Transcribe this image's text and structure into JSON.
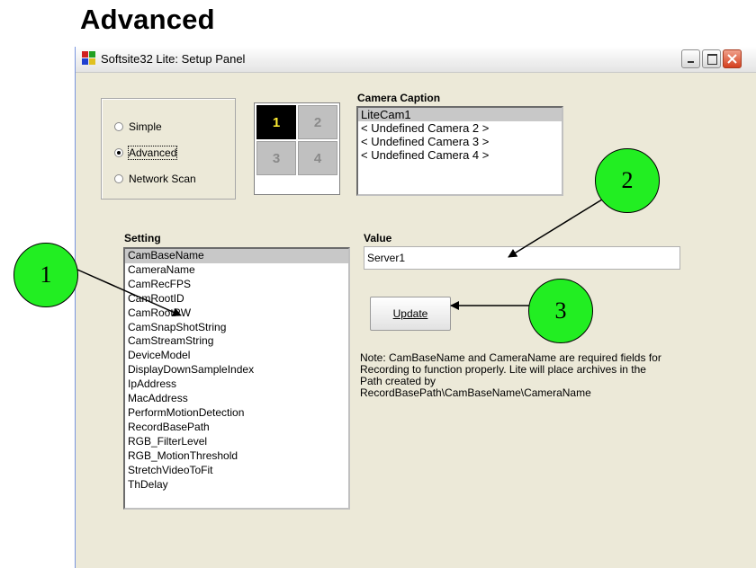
{
  "heading": "Advanced",
  "window": {
    "title": "Softsite32 Lite: Setup Panel"
  },
  "modes": [
    {
      "label": "Simple",
      "selected": false
    },
    {
      "label": "Advanced",
      "selected": true
    },
    {
      "label": "Network Scan",
      "selected": false
    }
  ],
  "layout_cells": [
    "1",
    "2",
    "3",
    "4"
  ],
  "camera_caption": {
    "label": "Camera Caption",
    "items": [
      "LiteCam1",
      "< Undefined Camera 2 >",
      "< Undefined Camera 3 >",
      "< Undefined Camera 4 >"
    ]
  },
  "setting": {
    "label": "Setting",
    "items": [
      "CamBaseName",
      "CameraName",
      "CamRecFPS",
      "CamRootID",
      "CamRootPW",
      "CamSnapShotString",
      "CamStreamString",
      "DeviceModel",
      "DisplayDownSampleIndex",
      "IpAddress",
      "MacAddress",
      "PerformMotionDetection",
      "RecordBasePath",
      "RGB_FilterLevel",
      "RGB_MotionThreshold",
      "StretchVideoToFit",
      "ThDelay"
    ]
  },
  "value": {
    "label": "Value",
    "text": "Server1"
  },
  "update_button": "Update",
  "note": {
    "line1": "Note: CamBaseName and CameraName are required fields for",
    "line2": "Recording to function properly. Lite will place archives in the",
    "line3": "Path created by",
    "line4": "RecordBasePath\\CamBaseName\\CameraName"
  },
  "callouts": [
    "1",
    "2",
    "3"
  ],
  "colors": {
    "callout": "#22ee22",
    "selected_cell": "#000000",
    "selected_digit": "#ffee33"
  }
}
